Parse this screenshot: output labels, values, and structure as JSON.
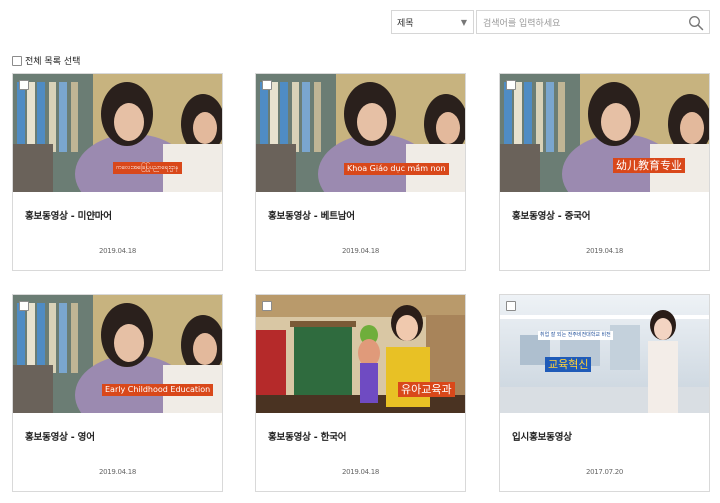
{
  "search": {
    "field_select": "제목",
    "placeholder": "검색어를 입력하세요"
  },
  "select_all_label": "전체 목록 선택",
  "cards": [
    {
      "title": "홍보동영상 - 미얀마어",
      "date": "2019.04.18",
      "caption": "ကလေးအခြေပြုပညာရေးဌာန"
    },
    {
      "title": "홍보동영상 - 베트남어",
      "date": "2019.04.18",
      "caption": "Khoa Giáo dục mầm non"
    },
    {
      "title": "홍보동영상 - 중국어",
      "date": "2019.04.18",
      "caption": "幼儿教育专业"
    },
    {
      "title": "홍보동영상 - 영어",
      "date": "2019.04.18",
      "caption": "Early Childhood Education"
    },
    {
      "title": "홍보동영상 - 한국어",
      "date": "2019.04.18",
      "caption": "유아교육과"
    },
    {
      "title": "입시홍보동영상",
      "date": "2017.07.20",
      "caption": "교육혁신",
      "tagline": "취업 잘 되는 전주비전대학교 비전"
    }
  ],
  "colors": {
    "caption_bg": "#d9481a",
    "border": "#d9d9d9"
  }
}
